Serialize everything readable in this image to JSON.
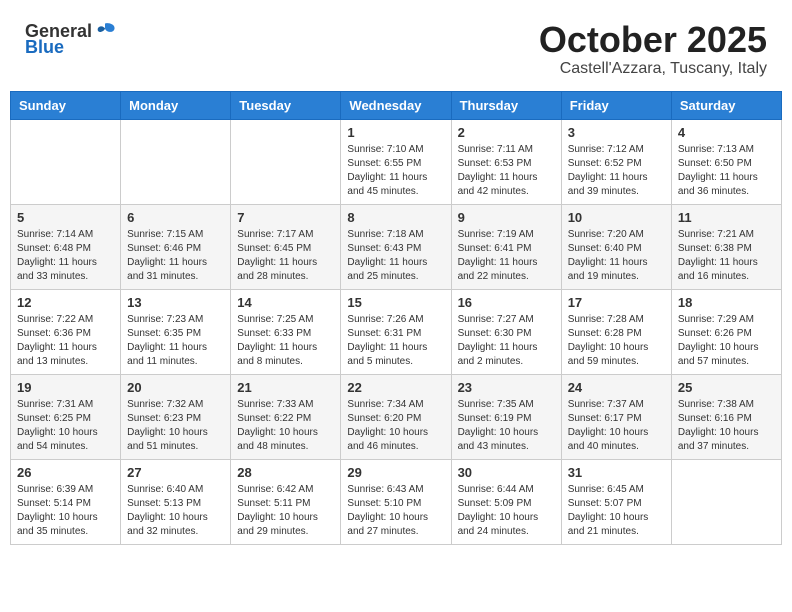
{
  "header": {
    "logo_general": "General",
    "logo_blue": "Blue",
    "month": "October 2025",
    "location": "Castell'Azzara, Tuscany, Italy"
  },
  "days_of_week": [
    "Sunday",
    "Monday",
    "Tuesday",
    "Wednesday",
    "Thursday",
    "Friday",
    "Saturday"
  ],
  "weeks": [
    [
      {
        "day": "",
        "content": ""
      },
      {
        "day": "",
        "content": ""
      },
      {
        "day": "",
        "content": ""
      },
      {
        "day": "1",
        "content": "Sunrise: 7:10 AM\nSunset: 6:55 PM\nDaylight: 11 hours and 45 minutes."
      },
      {
        "day": "2",
        "content": "Sunrise: 7:11 AM\nSunset: 6:53 PM\nDaylight: 11 hours and 42 minutes."
      },
      {
        "day": "3",
        "content": "Sunrise: 7:12 AM\nSunset: 6:52 PM\nDaylight: 11 hours and 39 minutes."
      },
      {
        "day": "4",
        "content": "Sunrise: 7:13 AM\nSunset: 6:50 PM\nDaylight: 11 hours and 36 minutes."
      }
    ],
    [
      {
        "day": "5",
        "content": "Sunrise: 7:14 AM\nSunset: 6:48 PM\nDaylight: 11 hours and 33 minutes."
      },
      {
        "day": "6",
        "content": "Sunrise: 7:15 AM\nSunset: 6:46 PM\nDaylight: 11 hours and 31 minutes."
      },
      {
        "day": "7",
        "content": "Sunrise: 7:17 AM\nSunset: 6:45 PM\nDaylight: 11 hours and 28 minutes."
      },
      {
        "day": "8",
        "content": "Sunrise: 7:18 AM\nSunset: 6:43 PM\nDaylight: 11 hours and 25 minutes."
      },
      {
        "day": "9",
        "content": "Sunrise: 7:19 AM\nSunset: 6:41 PM\nDaylight: 11 hours and 22 minutes."
      },
      {
        "day": "10",
        "content": "Sunrise: 7:20 AM\nSunset: 6:40 PM\nDaylight: 11 hours and 19 minutes."
      },
      {
        "day": "11",
        "content": "Sunrise: 7:21 AM\nSunset: 6:38 PM\nDaylight: 11 hours and 16 minutes."
      }
    ],
    [
      {
        "day": "12",
        "content": "Sunrise: 7:22 AM\nSunset: 6:36 PM\nDaylight: 11 hours and 13 minutes."
      },
      {
        "day": "13",
        "content": "Sunrise: 7:23 AM\nSunset: 6:35 PM\nDaylight: 11 hours and 11 minutes."
      },
      {
        "day": "14",
        "content": "Sunrise: 7:25 AM\nSunset: 6:33 PM\nDaylight: 11 hours and 8 minutes."
      },
      {
        "day": "15",
        "content": "Sunrise: 7:26 AM\nSunset: 6:31 PM\nDaylight: 11 hours and 5 minutes."
      },
      {
        "day": "16",
        "content": "Sunrise: 7:27 AM\nSunset: 6:30 PM\nDaylight: 11 hours and 2 minutes."
      },
      {
        "day": "17",
        "content": "Sunrise: 7:28 AM\nSunset: 6:28 PM\nDaylight: 10 hours and 59 minutes."
      },
      {
        "day": "18",
        "content": "Sunrise: 7:29 AM\nSunset: 6:26 PM\nDaylight: 10 hours and 57 minutes."
      }
    ],
    [
      {
        "day": "19",
        "content": "Sunrise: 7:31 AM\nSunset: 6:25 PM\nDaylight: 10 hours and 54 minutes."
      },
      {
        "day": "20",
        "content": "Sunrise: 7:32 AM\nSunset: 6:23 PM\nDaylight: 10 hours and 51 minutes."
      },
      {
        "day": "21",
        "content": "Sunrise: 7:33 AM\nSunset: 6:22 PM\nDaylight: 10 hours and 48 minutes."
      },
      {
        "day": "22",
        "content": "Sunrise: 7:34 AM\nSunset: 6:20 PM\nDaylight: 10 hours and 46 minutes."
      },
      {
        "day": "23",
        "content": "Sunrise: 7:35 AM\nSunset: 6:19 PM\nDaylight: 10 hours and 43 minutes."
      },
      {
        "day": "24",
        "content": "Sunrise: 7:37 AM\nSunset: 6:17 PM\nDaylight: 10 hours and 40 minutes."
      },
      {
        "day": "25",
        "content": "Sunrise: 7:38 AM\nSunset: 6:16 PM\nDaylight: 10 hours and 37 minutes."
      }
    ],
    [
      {
        "day": "26",
        "content": "Sunrise: 6:39 AM\nSunset: 5:14 PM\nDaylight: 10 hours and 35 minutes."
      },
      {
        "day": "27",
        "content": "Sunrise: 6:40 AM\nSunset: 5:13 PM\nDaylight: 10 hours and 32 minutes."
      },
      {
        "day": "28",
        "content": "Sunrise: 6:42 AM\nSunset: 5:11 PM\nDaylight: 10 hours and 29 minutes."
      },
      {
        "day": "29",
        "content": "Sunrise: 6:43 AM\nSunset: 5:10 PM\nDaylight: 10 hours and 27 minutes."
      },
      {
        "day": "30",
        "content": "Sunrise: 6:44 AM\nSunset: 5:09 PM\nDaylight: 10 hours and 24 minutes."
      },
      {
        "day": "31",
        "content": "Sunrise: 6:45 AM\nSunset: 5:07 PM\nDaylight: 10 hours and 21 minutes."
      },
      {
        "day": "",
        "content": ""
      }
    ]
  ]
}
